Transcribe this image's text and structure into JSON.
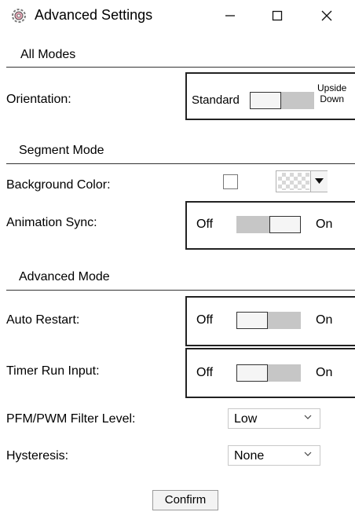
{
  "window": {
    "title": "Advanced Settings",
    "icon": "gear-icon",
    "controls": [
      "minimize-icon",
      "maximize-icon",
      "close-icon"
    ]
  },
  "sections": {
    "all_modes": "All Modes",
    "segment_mode": "Segment Mode",
    "advanced_mode": "Advanced Mode"
  },
  "orientation": {
    "label": "Orientation:",
    "left_option": "Standard",
    "right_option_line1": "Upside",
    "right_option_line2": "Down",
    "selected": "Standard"
  },
  "background_color": {
    "label": "Background Color:",
    "checked": false,
    "swatch": "transparent-checker",
    "dropdown_icon": "chevron-down-icon"
  },
  "animation_sync": {
    "label": "Animation Sync:",
    "off_label": "Off",
    "on_label": "On",
    "state": "On"
  },
  "auto_restart": {
    "label": "Auto Restart:",
    "off_label": "Off",
    "on_label": "On",
    "state": "Off"
  },
  "timer_run_input": {
    "label": "Timer Run Input:",
    "off_label": "Off",
    "on_label": "On",
    "state": "Off"
  },
  "filter_level": {
    "label": "PFM/PWM Filter Level:",
    "value": "Low"
  },
  "hysteresis": {
    "label": "Hysteresis:",
    "value": "None"
  },
  "confirm_label": "Confirm",
  "colors": {
    "switch_track": "#c6c6c6",
    "rule": "#333333",
    "border": "#222222"
  }
}
